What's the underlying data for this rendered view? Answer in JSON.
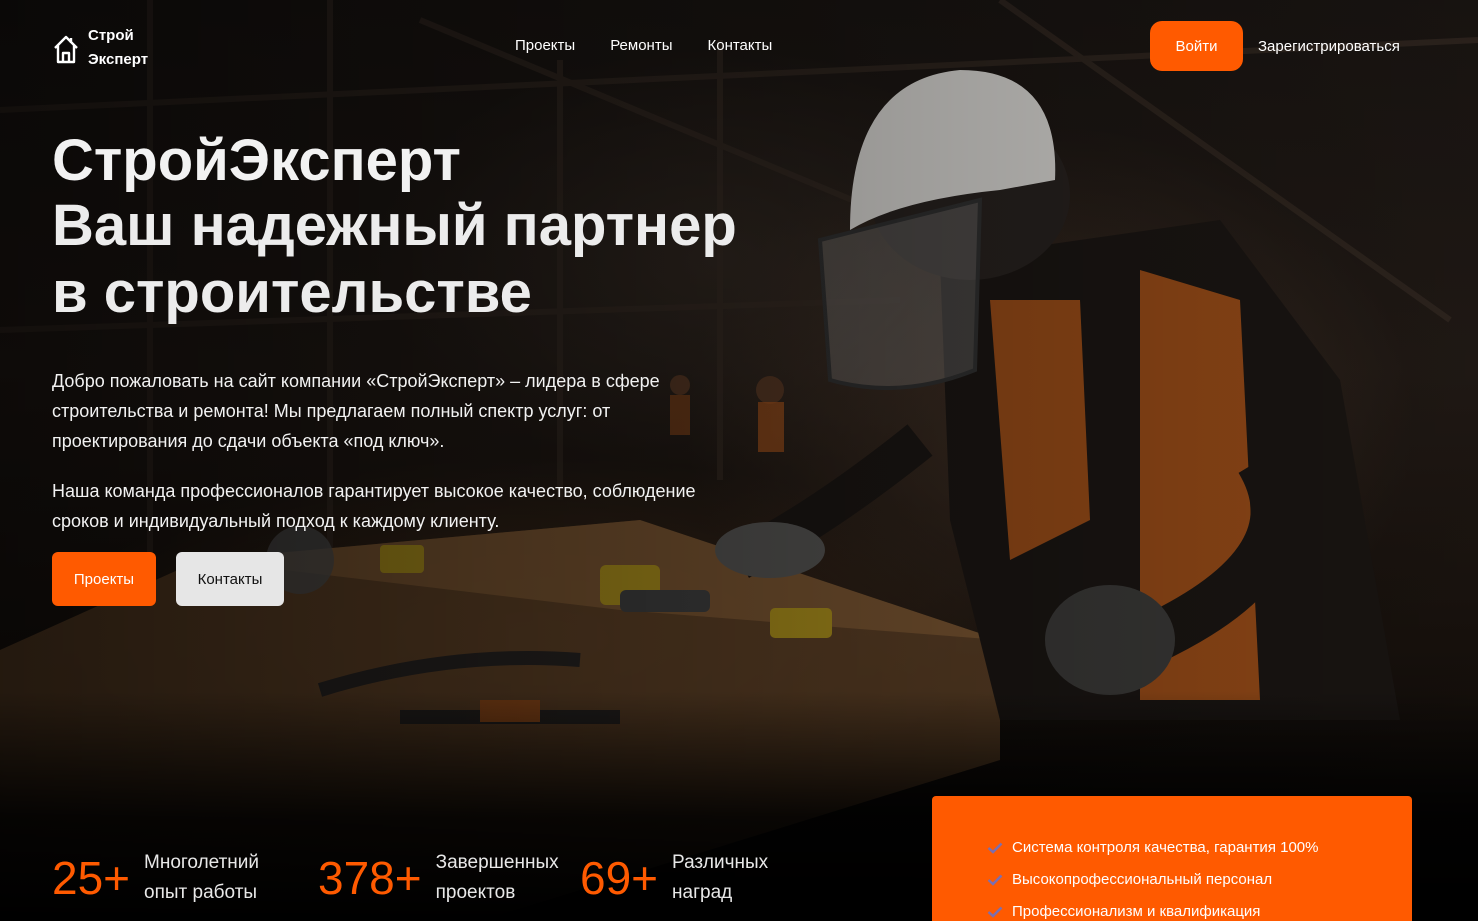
{
  "header": {
    "logo_line1": "Строй",
    "logo_line2": "Эксперт",
    "nav": [
      "Проекты",
      "Ремонты",
      "Контакты"
    ],
    "login_label": "Войти",
    "register_label": "Зарегистрироваться"
  },
  "hero": {
    "brand": "СтройЭксперт",
    "tagline_prefix": "Ваш ",
    "tagline_bold": "надежный",
    "tagline_suffix": " партнер",
    "tagline_line2": "в строительстве",
    "paragraph1": "Добро пожаловать на сайт компании «СтройЭксперт» – лидера в сфере строительства и ремонта! Мы предлагаем полный спектр услуг: от проектирования до сдачи объекта «под ключ».",
    "paragraph2": "Наша команда профессионалов гарантирует высокое качество, соблюдение сроков и индивидуальный подход к каждому клиенту.",
    "projects_button": "Проекты",
    "contacts_button": "Контакты"
  },
  "stats": [
    {
      "value": "25+",
      "label_line1": "Многолетний",
      "label_line2": "опыт работы"
    },
    {
      "value": "378+",
      "label_line1": "Завершенных",
      "label_line2": "проектов"
    },
    {
      "value": "69+",
      "label_line1": "Различных",
      "label_line2": "наград"
    }
  ],
  "features": [
    "Система контроля качества, гарантия 100%",
    "Высокопрофессиональный персонал",
    "Профессионализм и квалификация"
  ],
  "colors": {
    "accent": "#ff5a00",
    "check": "#7b6fb0"
  },
  "icons": {
    "logo": "house-icon",
    "feature": "check-icon"
  }
}
